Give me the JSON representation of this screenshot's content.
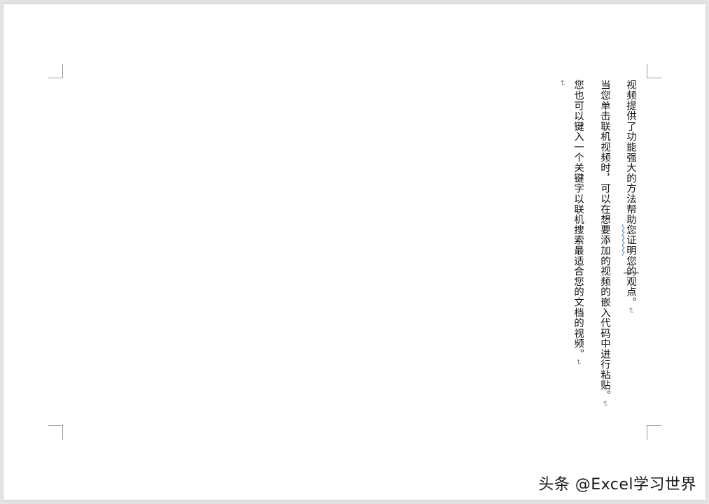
{
  "document": {
    "paragraphs": [
      {
        "before": "视频提供了功能强大的方法帮助",
        "flagged": "您证明",
        "after": "您的观点。"
      },
      {
        "text": "当您单击联机视频时，可以在想要添加的视频的嵌入代码中进行粘贴。"
      },
      {
        "text": "您也可以键入一个关键字以联机搜索最适合您的文档的视频。"
      }
    ],
    "paragraph_mark": "↵"
  },
  "watermark": {
    "text": "头条 @Excel学习世界"
  }
}
